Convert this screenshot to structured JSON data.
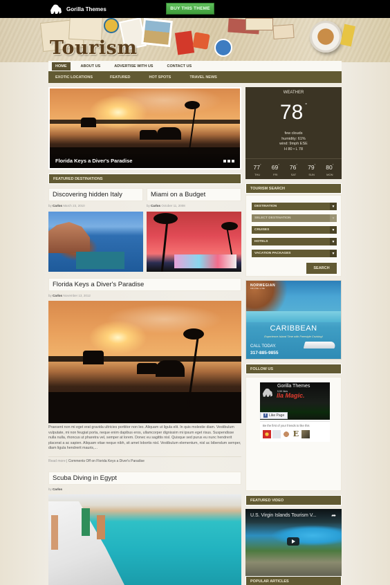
{
  "topbar": {
    "brand_name": "Gorilla Themes",
    "buy_button": "BUY THIS THEME",
    "buy_button_color": "#4cae4a"
  },
  "header": {
    "logo_text": "Tourism"
  },
  "nav": {
    "primary": [
      {
        "label": "HOME",
        "active": true
      },
      {
        "label": "ABOUT US",
        "active": false
      },
      {
        "label": "ADVERTISE WITH US",
        "active": false
      },
      {
        "label": "CONTACT US",
        "active": false
      }
    ],
    "secondary": [
      {
        "label": "EXOTIC LOCATIONS"
      },
      {
        "label": "FEATURED"
      },
      {
        "label": "HOT SPOTS"
      },
      {
        "label": "TRAVEL NEWS"
      }
    ]
  },
  "theme": {
    "accent": "#625a33",
    "accent_dark": "#3b3424",
    "background": "#f1eee7"
  },
  "slider": {
    "caption": "Florida Keys a Diver's Paradise",
    "slide_count": 3
  },
  "featured": {
    "section_title": "FEATURED DESTINATIONS",
    "posts": [
      {
        "title": "Discovering hidden Italy",
        "by": "by",
        "author": "Carlos",
        "date": "March 23, 2010"
      },
      {
        "title": "Miami on a Budget",
        "by": "by",
        "author": "Carlos",
        "date": "October 11, 2008"
      }
    ]
  },
  "posts": [
    {
      "title": "Florida Keys a Diver's Paradise",
      "by": "by",
      "author": "Carlos",
      "date": "November 13, 2012",
      "excerpt": "Praesent non mi eget erat gravida ultricies porttitor non leo. Aliquam ut ligula elit. In quis molestie diam. Vestibulum vulputate, mi non feugiat porta, neque enim dapibus eros, ullamcorper dignissim mi ipsum eget risus. Suspendisse nulla nulla, rhoncus ut pharetra vel, semper at lorem. Donec eu sagittis nisl. Quisque sed purus eu nunc hendrerit placerat a ac sapien. Aliquam vitae neque nibh, sit amet lobortis nisl. Vestibulum elementum, nisl ac bibendum semper, diam ligula hendrerit mauris,...",
      "read_more": "Read more",
      "separator": " | ",
      "comments": "Comments Off on Florida Keys a Diver's Paradise"
    },
    {
      "title": "Scuba Diving in Egypt",
      "by": "by",
      "author": "Carlos"
    }
  ],
  "weather": {
    "title": "WEATHER",
    "temp": "78",
    "degree": "°",
    "condition": "few clouds",
    "humidity": "humidity: 61%",
    "wind": "wind: 9mph ESE",
    "hilo": "H 80 • L 78",
    "forecast": [
      {
        "temp": "77",
        "day": "THU"
      },
      {
        "temp": "69",
        "day": "FRI"
      },
      {
        "temp": "76",
        "day": "SAT"
      },
      {
        "temp": "79",
        "day": "SUN"
      },
      {
        "temp": "80",
        "day": "MON"
      }
    ]
  },
  "tourism_search": {
    "title": "TOURISM SEARCH",
    "selects": [
      {
        "label": "DESTINATION",
        "disabled": false
      },
      {
        "label": "SELECT DESTINATION",
        "disabled": true
      },
      {
        "label": "CRUISES",
        "disabled": false
      },
      {
        "label": "HOTELS",
        "disabled": false
      },
      {
        "label": "VACATION PACKAGES",
        "disabled": false
      }
    ],
    "button": "SEARCH"
  },
  "ad": {
    "brand": "NORWEGIAN",
    "brand_sub": "CRUISE LINE",
    "title": "CARIBBEAN",
    "tagline": "Experience Island Time with Freestyle Cruising!",
    "call": "CALL TODAY.",
    "phone": "317-885-9855"
  },
  "follow": {
    "title": "FOLLOW US",
    "fb_page_name": "Gorilla Themes",
    "fb_likes": "5,5K likes",
    "fb_cover_text": "lla Magic.",
    "fb_like_button": "Like Page",
    "fb_friends_text": "Be the first of your friends to like this"
  },
  "featured_video": {
    "title": "FEATURED VIDEO",
    "video_title": "U.S. Virgin Islands Tourism V...",
    "share_icon": "share-arrow-icon"
  },
  "popular_articles": {
    "title": "POPULAR ARTICLES"
  }
}
